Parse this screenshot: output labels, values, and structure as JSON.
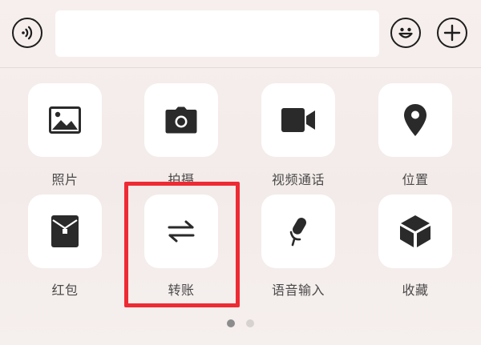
{
  "input": {
    "value": "",
    "placeholder": ""
  },
  "icons": {
    "voice": "voice-input-icon",
    "emoji": "emoji-icon",
    "plus": "plus-icon"
  },
  "panel": {
    "items": [
      {
        "label": "照片",
        "icon": "photo-icon"
      },
      {
        "label": "拍摄",
        "icon": "camera-icon"
      },
      {
        "label": "视频通话",
        "icon": "video-call-icon"
      },
      {
        "label": "位置",
        "icon": "location-icon"
      },
      {
        "label": "红包",
        "icon": "red-packet-icon"
      },
      {
        "label": "转账",
        "icon": "transfer-icon"
      },
      {
        "label": "语音输入",
        "icon": "microphone-icon"
      },
      {
        "label": "收藏",
        "icon": "favorites-icon"
      }
    ]
  },
  "pager": {
    "pages": 2,
    "current": 1
  },
  "colors": {
    "highlight": "#ee2a34",
    "background": "#f5eeec",
    "icon": "#2a2a2a",
    "tile": "#ffffff"
  }
}
